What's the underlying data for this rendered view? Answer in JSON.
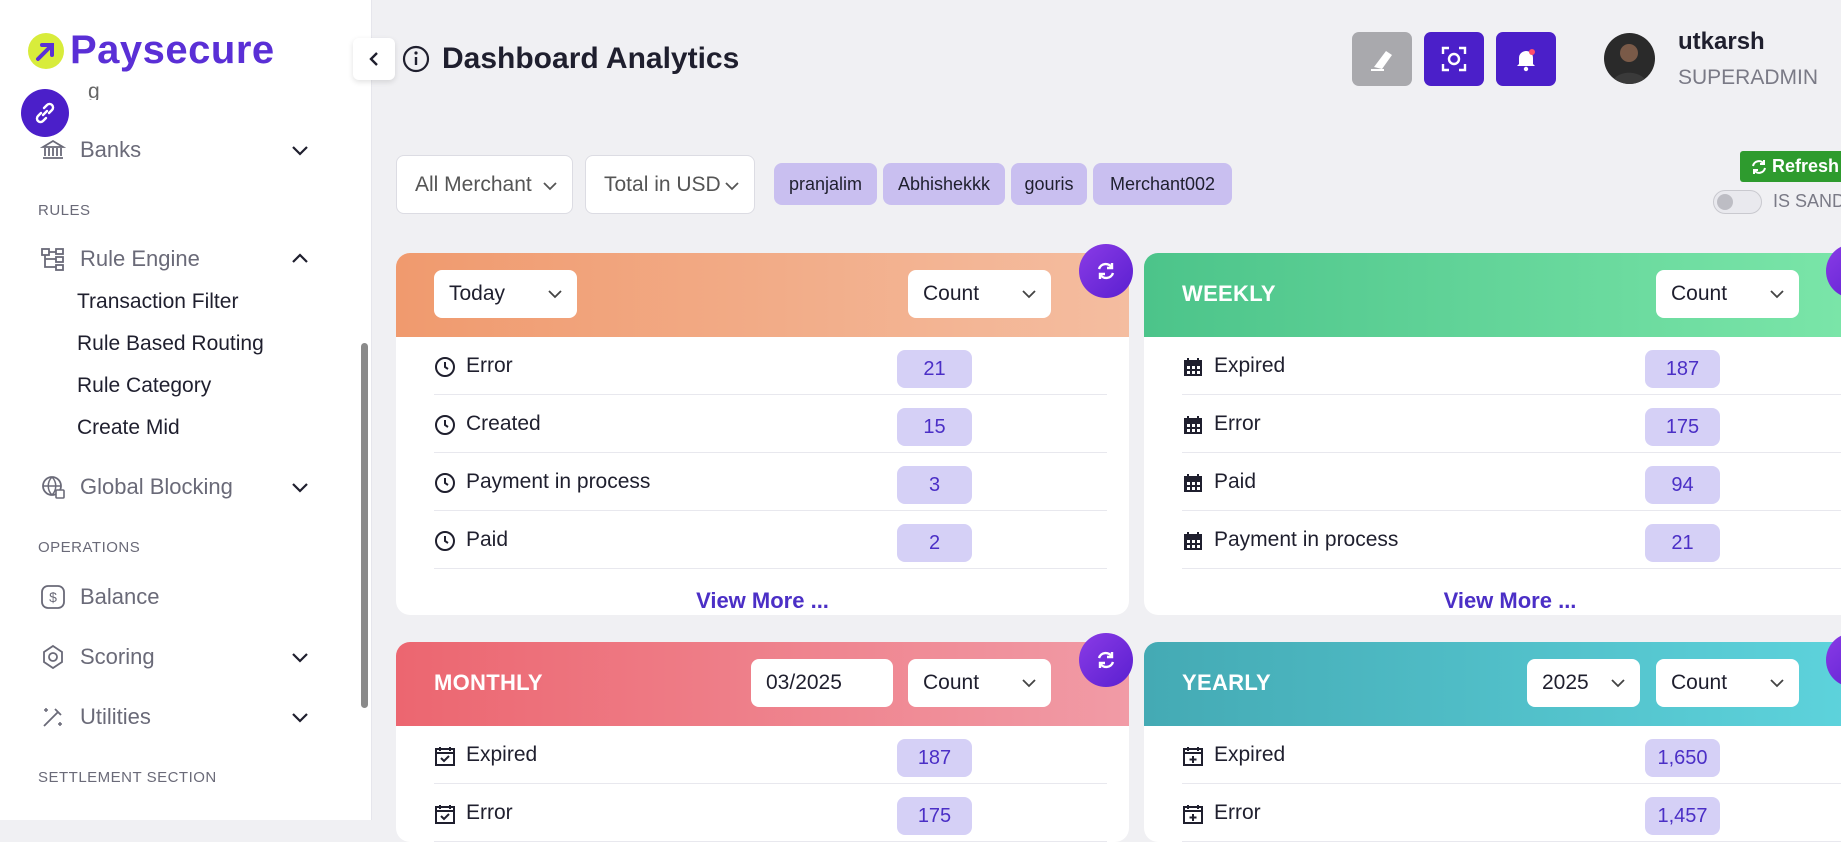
{
  "brand": {
    "name": "Paysecure"
  },
  "sidebar": {
    "banks": "Banks",
    "sections": {
      "rules": "RULES",
      "operations": "OPERATIONS",
      "settlement": "SETTLEMENT SECTION"
    },
    "rule_engine": {
      "label": "Rule Engine",
      "children": [
        "Transaction Filter",
        "Rule Based Routing",
        "Rule Category",
        "Create Mid"
      ]
    },
    "global_blocking": "Global Blocking",
    "balance": "Balance",
    "scoring": "Scoring",
    "utilities": "Utilities"
  },
  "header": {
    "title": "Dashboard Analytics",
    "user": {
      "name": "utkarsh",
      "role": "SUPERADMIN"
    }
  },
  "filters": {
    "merchant_select": "All Merchant",
    "currency_select": "Total in USD",
    "chips": [
      "pranjalim",
      "Abhishekkk",
      "gouris",
      "Merchant002"
    ],
    "refresh_label": "Refresh",
    "sandbox_label": "IS SANDBOX"
  },
  "cards": {
    "today": {
      "period_select": "Today",
      "metric_select": "Count",
      "rows": [
        {
          "label": "Error",
          "value": "21"
        },
        {
          "label": "Created",
          "value": "15"
        },
        {
          "label": "Payment in process",
          "value": "3"
        },
        {
          "label": "Paid",
          "value": "2"
        }
      ],
      "view_more": "View More ..."
    },
    "weekly": {
      "title": "WEEKLY",
      "metric_select": "Count",
      "rows": [
        {
          "label": "Expired",
          "value": "187"
        },
        {
          "label": "Error",
          "value": "175"
        },
        {
          "label": "Paid",
          "value": "94"
        },
        {
          "label": "Payment in process",
          "value": "21"
        }
      ],
      "view_more": "View More ..."
    },
    "monthly": {
      "title": "MONTHLY",
      "month_value": "03/2025",
      "metric_select": "Count",
      "rows": [
        {
          "label": "Expired",
          "value": "187"
        },
        {
          "label": "Error",
          "value": "175"
        }
      ]
    },
    "yearly": {
      "title": "YEARLY",
      "year_select": "2025",
      "metric_select": "Count",
      "rows": [
        {
          "label": "Expired",
          "value": "1,650"
        },
        {
          "label": "Error",
          "value": "1,457"
        }
      ]
    }
  },
  "colors": {
    "primary": "#4b1fc9",
    "today_gradient": [
      "#f09a6e",
      "#f4bda0"
    ],
    "weekly_gradient": [
      "#4cc48a",
      "#7ee8ab"
    ],
    "monthly_gradient": [
      "#ec6670",
      "#f19ba6"
    ],
    "yearly_gradient": [
      "#44aab4",
      "#5fd6df"
    ],
    "refresh_green": "#2e9b2e"
  }
}
